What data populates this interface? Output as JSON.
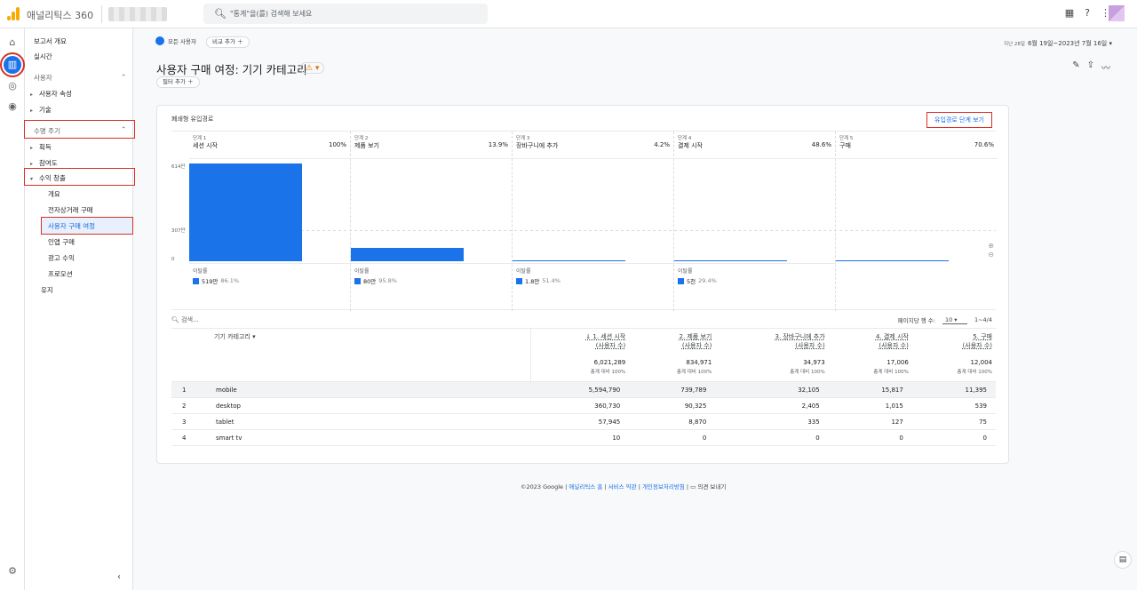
{
  "app": {
    "name": "애널리틱스 360"
  },
  "search": {
    "placeholder": "\"통계\"을(를) 검색해 보세요"
  },
  "sidebar": {
    "items": [
      {
        "label": "보고서 개요"
      },
      {
        "label": "실시간"
      },
      {
        "label": "사용자"
      },
      {
        "label": "사용자 속성"
      },
      {
        "label": "기술"
      },
      {
        "label": "수명 주기"
      },
      {
        "label": "획득"
      },
      {
        "label": "참여도"
      },
      {
        "label": "수익 창출"
      },
      {
        "label": "개요"
      },
      {
        "label": "전자상거래 구매"
      },
      {
        "label": "사용자 구매 여정"
      },
      {
        "label": "인앱 구매"
      },
      {
        "label": "광고 수익"
      },
      {
        "label": "프로모션"
      },
      {
        "label": "유지"
      }
    ]
  },
  "header": {
    "segment": "모든 사용자",
    "compare": "비교 추가",
    "date_prefix": "지난 28일",
    "date_range": "6월 19일~2023년 7월 16일",
    "title": "사용자 구매 여정: 기기 카테고리",
    "filter": "필터 추가"
  },
  "funnel": {
    "card_title": "폐쇄형 유입경로",
    "link": "유입경로 단계 보기",
    "y_ticks": [
      "614만",
      "307만",
      "0"
    ],
    "drop_label": "이탈률",
    "steps": [
      {
        "label": "단계 1",
        "name": "세션 시작",
        "pct": "100%",
        "drop": "519만",
        "drop_pct": "86.1%",
        "value": 6021289
      },
      {
        "label": "단계 2",
        "name": "제품 보기",
        "pct": "13.9%",
        "drop": "80만",
        "drop_pct": "95.8%",
        "value": 834971
      },
      {
        "label": "단계 3",
        "name": "장바구니에 추가",
        "pct": "4.2%",
        "drop": "1.8만",
        "drop_pct": "51.4%",
        "value": 34973
      },
      {
        "label": "단계 4",
        "name": "결제 시작",
        "pct": "48.6%",
        "drop": "5천",
        "drop_pct": "29.4%",
        "value": 17006
      },
      {
        "label": "단계 5",
        "name": "구매",
        "pct": "70.6%",
        "value": 12004
      }
    ]
  },
  "table": {
    "search_placeholder": "검색...",
    "rows_per_page_label": "페이지당 행 수:",
    "rows_per_page": "10",
    "range": "1~4/4",
    "dim_header": "기기 카테고리",
    "columns": [
      {
        "title": "↓ 1. 세션 시작",
        "sub": "(사용자 수)",
        "total": "6,021,289",
        "pct": "총계 대비 100%"
      },
      {
        "title": "2. 제품 보기",
        "sub": "(사용자 수)",
        "total": "834,971",
        "pct": "총계 대비 100%"
      },
      {
        "title": "3. 장바구니에 추가",
        "sub": "(사용자 수)",
        "total": "34,973",
        "pct": "총계 대비 100%"
      },
      {
        "title": "4. 결제 시작",
        "sub": "(사용자 수)",
        "total": "17,006",
        "pct": "총계 대비 100%"
      },
      {
        "title": "5. 구매",
        "sub": "(사용자 수)",
        "total": "12,004",
        "pct": "총계 대비 100%"
      }
    ],
    "rows": [
      {
        "idx": "1",
        "cat": "mobile",
        "v": [
          "5,594,790",
          "739,789",
          "32,105",
          "15,817",
          "11,395"
        ]
      },
      {
        "idx": "2",
        "cat": "desktop",
        "v": [
          "360,730",
          "90,325",
          "2,405",
          "1,015",
          "539"
        ]
      },
      {
        "idx": "3",
        "cat": "tablet",
        "v": [
          "57,945",
          "8,870",
          "335",
          "127",
          "75"
        ]
      },
      {
        "idx": "4",
        "cat": "smart tv",
        "v": [
          "10",
          "0",
          "0",
          "0",
          "0"
        ]
      }
    ]
  },
  "footer": {
    "copyright": "©2023 Google |",
    "links": [
      "애널리틱스 홈",
      "서비스 약관",
      "개인정보처리방침"
    ],
    "feedback": "의견 보내기"
  },
  "colors": {
    "accent": "#1a73e8",
    "highlight_box": "#d93025"
  }
}
